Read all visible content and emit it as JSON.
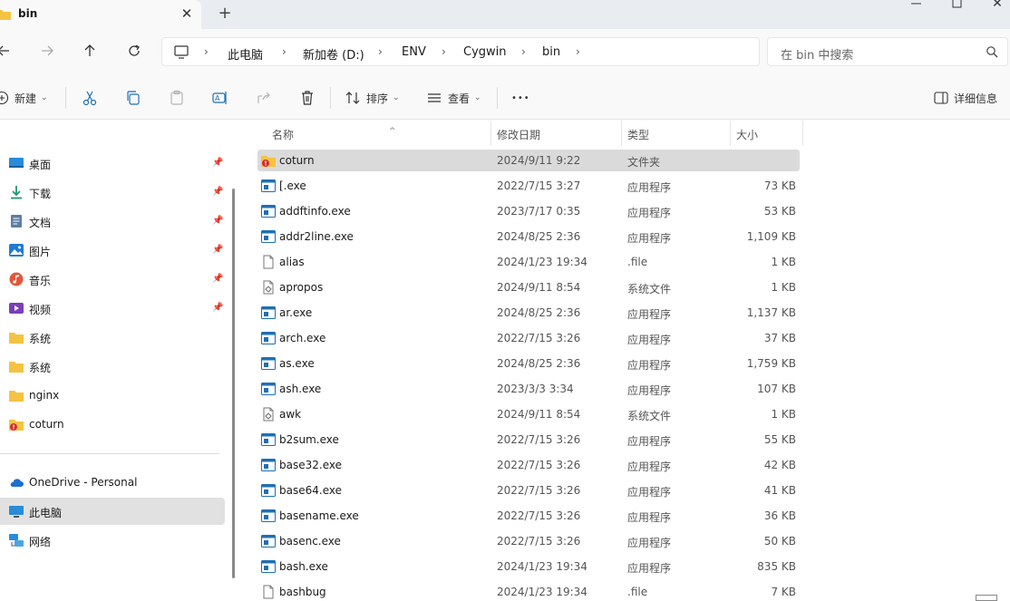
{
  "tab": {
    "title": "bin",
    "close_glyph": "✕",
    "new_glyph": "+"
  },
  "window_controls": {
    "close_glyph": "✕"
  },
  "breadcrumb": [
    "此电脑",
    "新加卷 (D:)",
    "ENV",
    "Cygwin",
    "bin"
  ],
  "breadcrumb_sep": "›",
  "search": {
    "placeholder": "在 bin 中搜索"
  },
  "toolbar": {
    "new_label": "新建",
    "sort_label": "排序",
    "view_label": "查看",
    "more_label": "•••",
    "details_label": "详细信息"
  },
  "sidebar": {
    "pinned": [
      {
        "label": "桌面",
        "icon": "desktop-icon"
      },
      {
        "label": "下载",
        "icon": "download-icon"
      },
      {
        "label": "文档",
        "icon": "document-icon"
      },
      {
        "label": "图片",
        "icon": "picture-icon"
      },
      {
        "label": "音乐",
        "icon": "music-icon"
      },
      {
        "label": "视频",
        "icon": "video-icon"
      }
    ],
    "folders": [
      {
        "label": "系统",
        "icon": "folder-icon"
      },
      {
        "label": "系统",
        "icon": "folder-icon"
      },
      {
        "label": "nginx",
        "icon": "folder-icon"
      },
      {
        "label": "coturn",
        "icon": "folder-warning-icon"
      }
    ],
    "locations": [
      {
        "label": "OneDrive - Personal",
        "icon": "cloud-icon"
      },
      {
        "label": "此电脑",
        "icon": "pc-icon",
        "selected": true
      },
      {
        "label": "网络",
        "icon": "network-icon"
      }
    ],
    "pin_glyph": "📌"
  },
  "columns": {
    "name": "名称",
    "date": "修改日期",
    "type": "类型",
    "size": "大小"
  },
  "sort_indicator": "^",
  "files": [
    {
      "name": "coturn",
      "date": "2024/9/11 9:22",
      "type": "文件夹",
      "size": "",
      "icon": "folder-warning-icon",
      "selected": true
    },
    {
      "name": "[.exe",
      "date": "2022/7/15 3:27",
      "type": "应用程序",
      "size": "73 KB",
      "icon": "exe-icon"
    },
    {
      "name": "addftinfo.exe",
      "date": "2023/7/17 0:35",
      "type": "应用程序",
      "size": "53 KB",
      "icon": "exe-icon"
    },
    {
      "name": "addr2line.exe",
      "date": "2024/8/25 2:36",
      "type": "应用程序",
      "size": "1,109 KB",
      "icon": "exe-icon"
    },
    {
      "name": "alias",
      "date": "2024/1/23 19:34",
      "type": ".file",
      "size": "1 KB",
      "icon": "file-icon"
    },
    {
      "name": "apropos",
      "date": "2024/9/11 8:54",
      "type": "系统文件",
      "size": "1 KB",
      "icon": "system-file-icon"
    },
    {
      "name": "ar.exe",
      "date": "2024/8/25 2:36",
      "type": "应用程序",
      "size": "1,137 KB",
      "icon": "exe-icon"
    },
    {
      "name": "arch.exe",
      "date": "2022/7/15 3:26",
      "type": "应用程序",
      "size": "37 KB",
      "icon": "exe-icon"
    },
    {
      "name": "as.exe",
      "date": "2024/8/25 2:36",
      "type": "应用程序",
      "size": "1,759 KB",
      "icon": "exe-icon"
    },
    {
      "name": "ash.exe",
      "date": "2023/3/3 3:34",
      "type": "应用程序",
      "size": "107 KB",
      "icon": "exe-icon"
    },
    {
      "name": "awk",
      "date": "2024/9/11 8:54",
      "type": "系统文件",
      "size": "1 KB",
      "icon": "system-file-icon"
    },
    {
      "name": "b2sum.exe",
      "date": "2022/7/15 3:26",
      "type": "应用程序",
      "size": "55 KB",
      "icon": "exe-icon"
    },
    {
      "name": "base32.exe",
      "date": "2022/7/15 3:26",
      "type": "应用程序",
      "size": "42 KB",
      "icon": "exe-icon"
    },
    {
      "name": "base64.exe",
      "date": "2022/7/15 3:26",
      "type": "应用程序",
      "size": "41 KB",
      "icon": "exe-icon"
    },
    {
      "name": "basename.exe",
      "date": "2022/7/15 3:26",
      "type": "应用程序",
      "size": "36 KB",
      "icon": "exe-icon"
    },
    {
      "name": "basenc.exe",
      "date": "2022/7/15 3:26",
      "type": "应用程序",
      "size": "50 KB",
      "icon": "exe-icon"
    },
    {
      "name": "bash.exe",
      "date": "2024/1/23 19:34",
      "type": "应用程序",
      "size": "835 KB",
      "icon": "exe-icon"
    },
    {
      "name": "bashbug",
      "date": "2024/1/23 19:34",
      "type": ".file",
      "size": "7 KB",
      "icon": "file-icon"
    }
  ],
  "colors": {
    "folder": "#f5c342",
    "exe": "#1f6fb5",
    "selection": "#dadada",
    "warning": "#d32f2f"
  }
}
